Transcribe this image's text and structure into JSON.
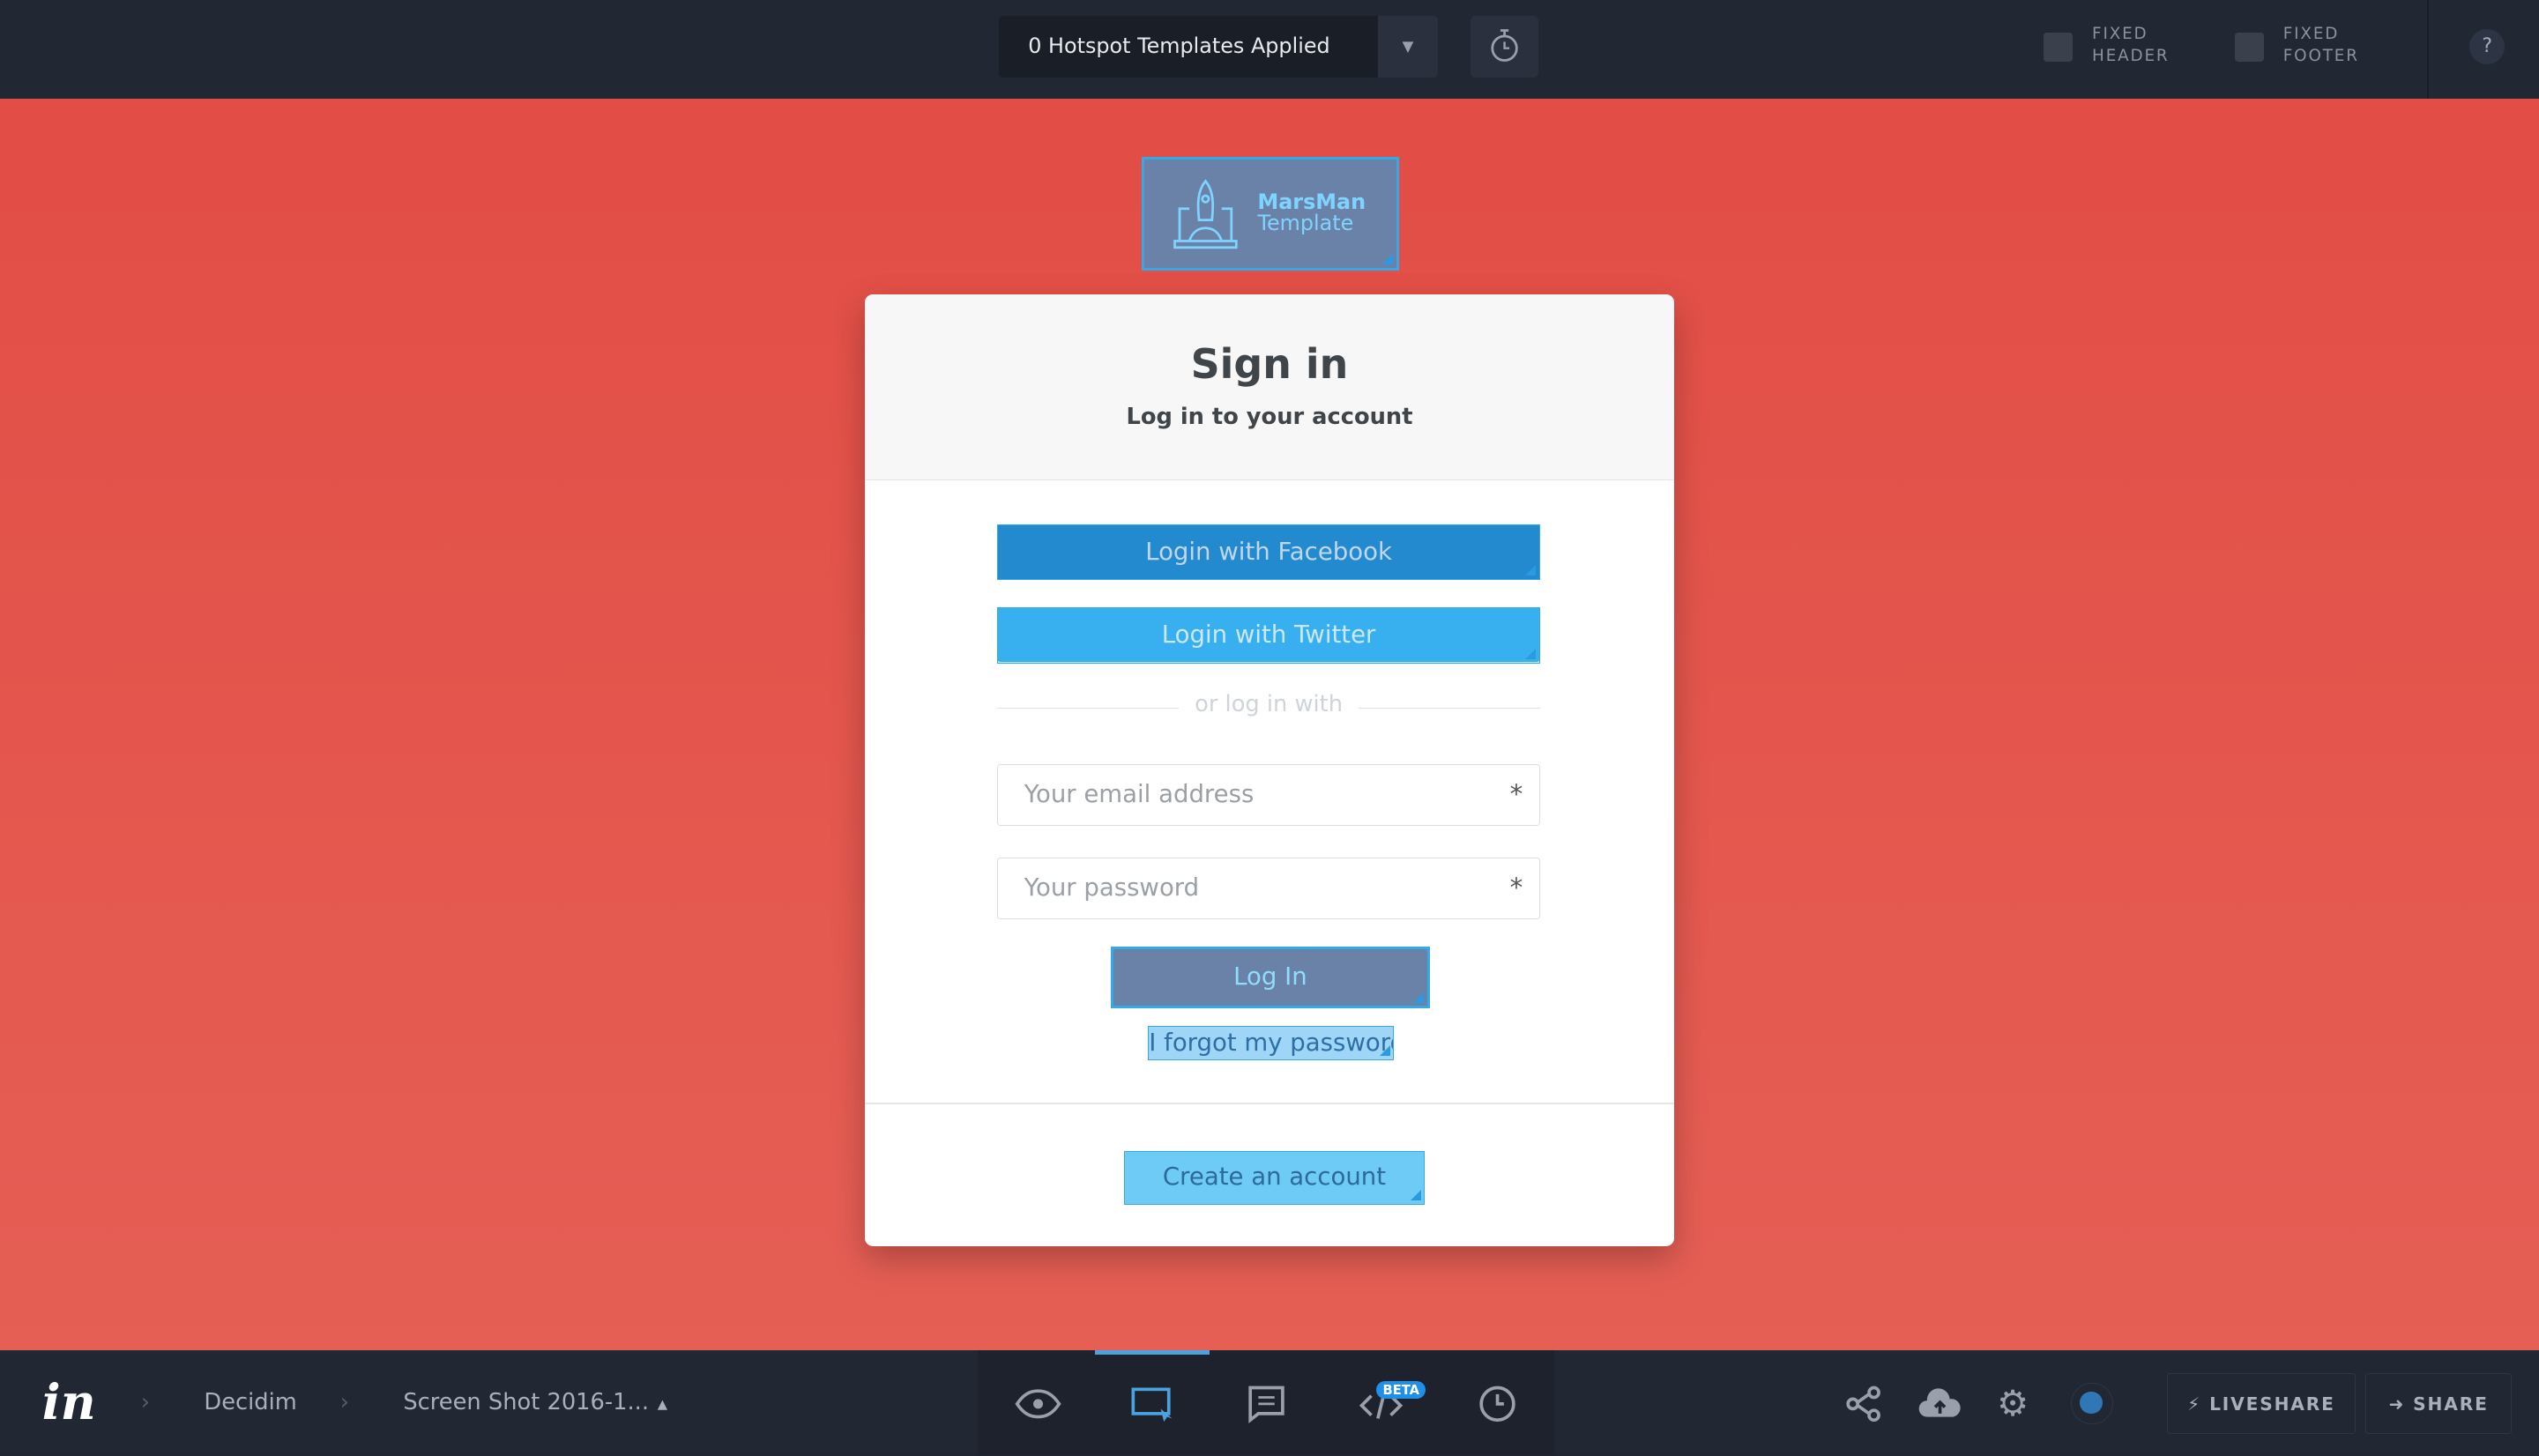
{
  "topbar": {
    "templates_label": "0 Hotspot Templates Applied",
    "fixed_header": "FIXED HEADER",
    "fixed_footer": "FIXED FOOTER",
    "help": "?"
  },
  "logo": {
    "line1": "MarsMan",
    "line2": "Template"
  },
  "card": {
    "title": "Sign in",
    "subtitle": "Log in to your account",
    "facebook": "Login with Facebook",
    "twitter": "Login with Twitter",
    "divider": "or log in with",
    "email_placeholder": "Your email address",
    "password_placeholder": "Your password",
    "required": "*",
    "login": "Log In",
    "forgot": "I forgot my password",
    "create": "Create an account"
  },
  "bottombar": {
    "crumb_project": "Decidim",
    "crumb_screen": "Screen Shot 2016-1...",
    "beta": "BETA",
    "liveshare": "LIVESHARE",
    "share": "SHARE"
  },
  "colors": {
    "canvas": "#e24d45",
    "facebook": "#2293d3",
    "twitter": "#2eaff0",
    "accent": "#35a8e8"
  }
}
